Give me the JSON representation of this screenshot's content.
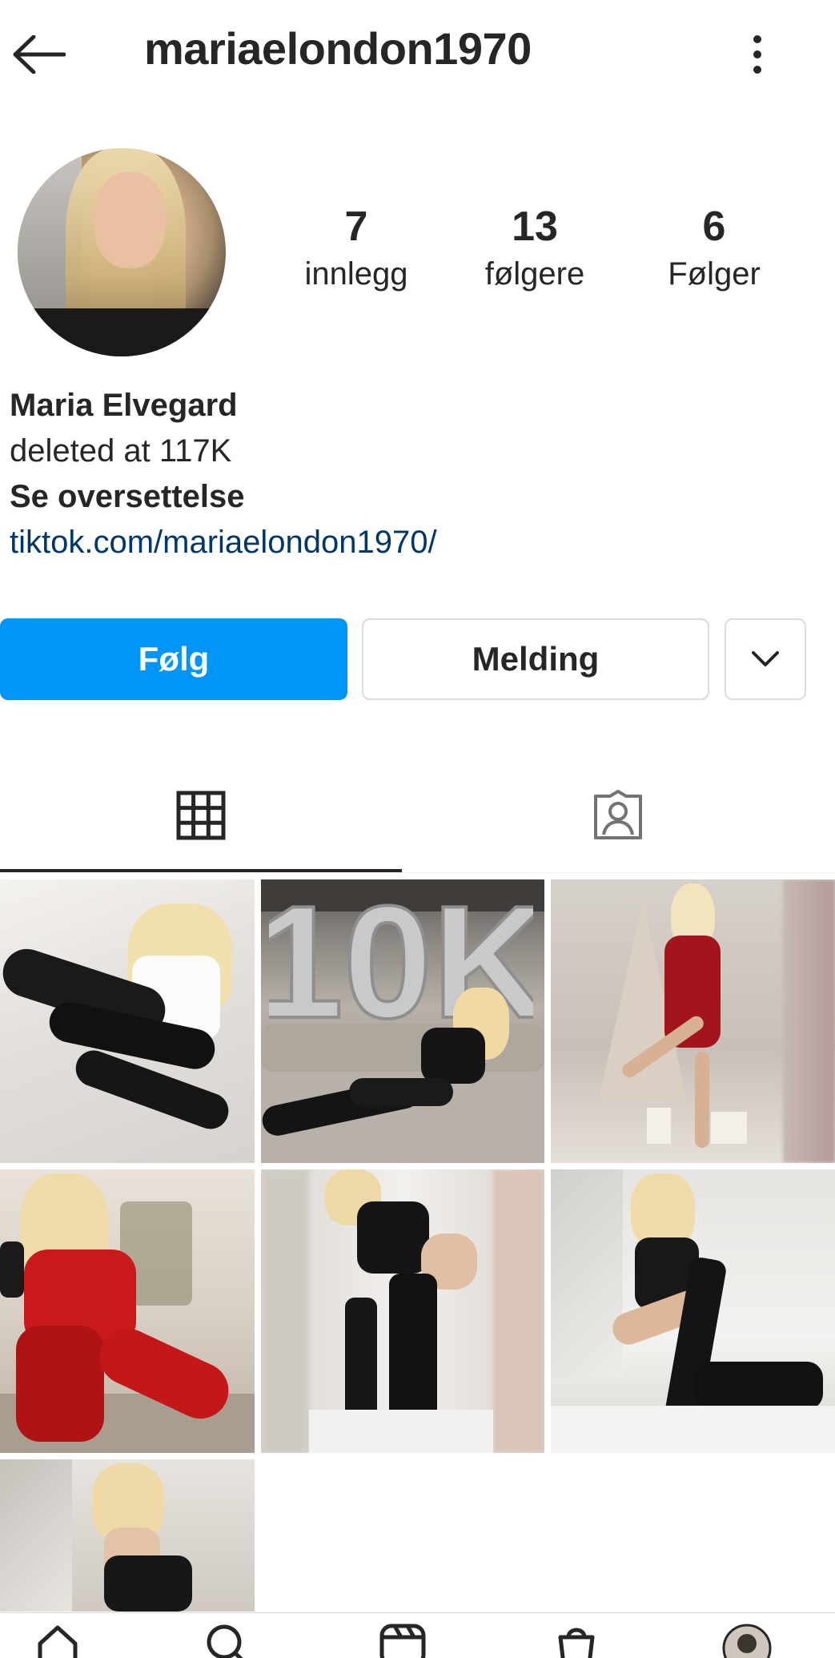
{
  "header": {
    "username": "mariaelondon1970",
    "back_icon": "arrow-left-icon",
    "more_icon": "more-vertical-icon"
  },
  "profile": {
    "avatar_icon": "profile-avatar",
    "stats": {
      "posts_count": "7",
      "posts_label": "innlegg",
      "followers_count": "13",
      "followers_label": "følgere",
      "following_count": "6",
      "following_label": "Følger"
    },
    "bio": {
      "name": "Maria Elvegard",
      "text": "deleted at 117K",
      "translate_label": "Se oversettelse",
      "link": "tiktok.com/mariaelondon1970/"
    }
  },
  "actions": {
    "follow_label": "Følg",
    "message_label": "Melding",
    "more_icon": "chevron-down-icon",
    "follow_color": "#0095f6"
  },
  "tabs": [
    {
      "icon": "grid-icon",
      "active": true
    },
    {
      "icon": "tagged-person-icon",
      "active": false
    }
  ],
  "grid": {
    "post_count_visible": 7,
    "overlay_text_post2": "10K"
  },
  "bottom_nav": [
    {
      "icon": "home-icon"
    },
    {
      "icon": "search-icon"
    },
    {
      "icon": "reels-icon"
    },
    {
      "icon": "shop-icon"
    },
    {
      "icon": "profile-avatar-icon"
    }
  ],
  "colors": {
    "text": "#262626",
    "link": "#00376b",
    "border": "#dbdbdb"
  }
}
